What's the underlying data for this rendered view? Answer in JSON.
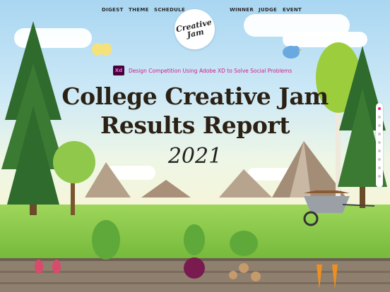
{
  "nav": {
    "left": [
      "DIGEST",
      "THEME",
      "SCHEDULE"
    ],
    "right": [
      "WINNER",
      "JUDGE",
      "EVENT"
    ]
  },
  "logo": {
    "text": "Creative Jam"
  },
  "subtitle": {
    "badge": "Xd",
    "text": "Design Competition Using Adobe XD to Solve Social Problems"
  },
  "title": {
    "line1": "College Creative Jam",
    "line2": "Results Report",
    "year": "2021"
  },
  "colors": {
    "accent": "#d21f8a",
    "xd_bg": "#470137",
    "title": "#2b2014"
  },
  "scroll_nav": {
    "dots": 9,
    "active_index": 0
  }
}
